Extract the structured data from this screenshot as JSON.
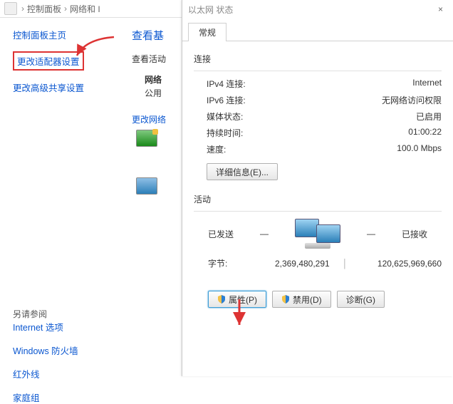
{
  "crumbs": {
    "home": "控制面板",
    "net": "网络和 I",
    "sep": "›"
  },
  "dlg_title_partial": "以太网 状态",
  "sidebar": {
    "home": "控制面板主页",
    "adapter": "更改适配器设置",
    "advshare": "更改高级共享设置",
    "seealso": "另请参阅",
    "inetopt": "Internet 选项",
    "firewall": "Windows 防火墙",
    "ir": "红外线",
    "homegroup": "家庭组"
  },
  "mid": {
    "h1": "查看基",
    "h2": "查看活动",
    "net_lbl": "网络",
    "pub": "公用",
    "chg": "更改网络"
  },
  "dlg": {
    "tab_general": "常规",
    "sect_conn": "连接",
    "rows": {
      "ipv4_l": "IPv4 连接:",
      "ipv4_r": "Internet",
      "ipv6_l": "IPv6 连接:",
      "ipv6_r": "无网络访问权限",
      "media_l": "媒体状态:",
      "media_r": "已启用",
      "dur_l": "持续时间:",
      "dur_r": "01:00:22",
      "speed_l": "速度:",
      "speed_r": "100.0 Mbps"
    },
    "btn_detail": "详细信息(E)...",
    "sect_act": "活动",
    "sent_lbl": "已发送",
    "recv_lbl": "已接收",
    "bytes_lbl": "字节:",
    "bytes_sent": "2,369,480,291",
    "bytes_recv": "120,625,969,660",
    "btn_prop": "属性(P)",
    "btn_disable": "禁用(D)",
    "btn_diag": "诊断(G)"
  }
}
